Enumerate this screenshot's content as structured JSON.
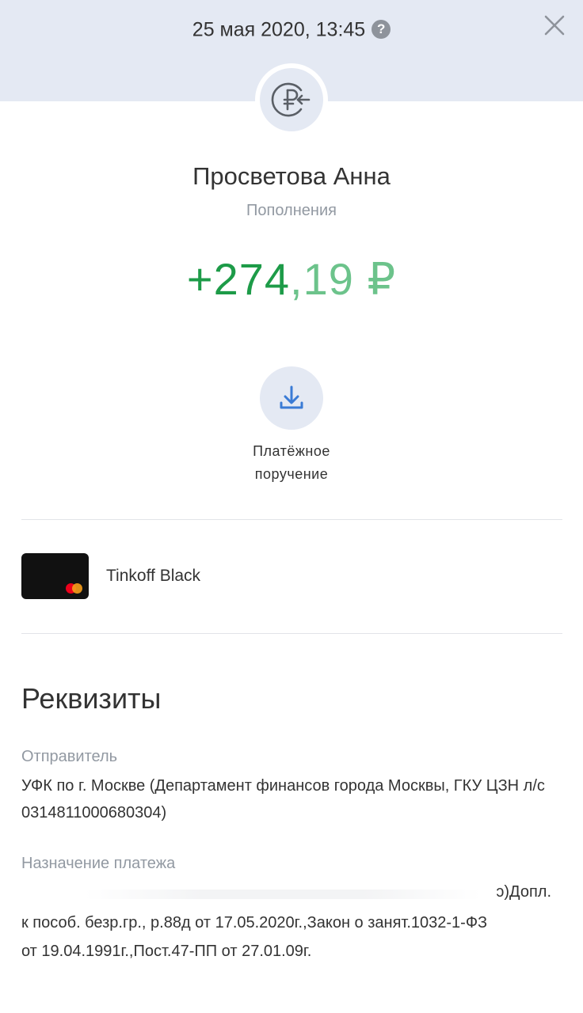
{
  "header": {
    "datetime": "25 мая 2020, 13:45",
    "help_glyph": "?",
    "help_icon": "question-circle-icon",
    "close_icon": "close-icon",
    "operation_icon": "ruble-incoming-icon"
  },
  "operation": {
    "counterparty": "Просветова Анна",
    "category": "Пополнения",
    "amount_int": "+274",
    "amount_frac": ",19 ₽"
  },
  "actions": {
    "payment_order_label": "Платёжное\nпоручение",
    "payment_order_icon": "download-icon"
  },
  "card": {
    "name": "Tinkoff Black"
  },
  "details": {
    "title": "Реквизиты",
    "sender_label": "Отправитель",
    "sender_value": "УФК по г. Москве (Департамент финансов города Москвы, ГКУ ЦЗН л/с 0314811000680304)",
    "purpose_label": "Назначение платежа",
    "purpose_line1": "ɔ)Допл.",
    "purpose_rest": "к пособ. безр.гр., р.88д от 17.05.2020г.,Закон о занят.1032-1-ФЗ\nот 19.04.1991г.,Пост.47-ПП от 27.01.09г."
  },
  "colors": {
    "accent": "#1d9b48",
    "accent_light": "#6cc38b",
    "header_bg": "#e4e9f3",
    "icon_blue": "#3a7bd5"
  }
}
